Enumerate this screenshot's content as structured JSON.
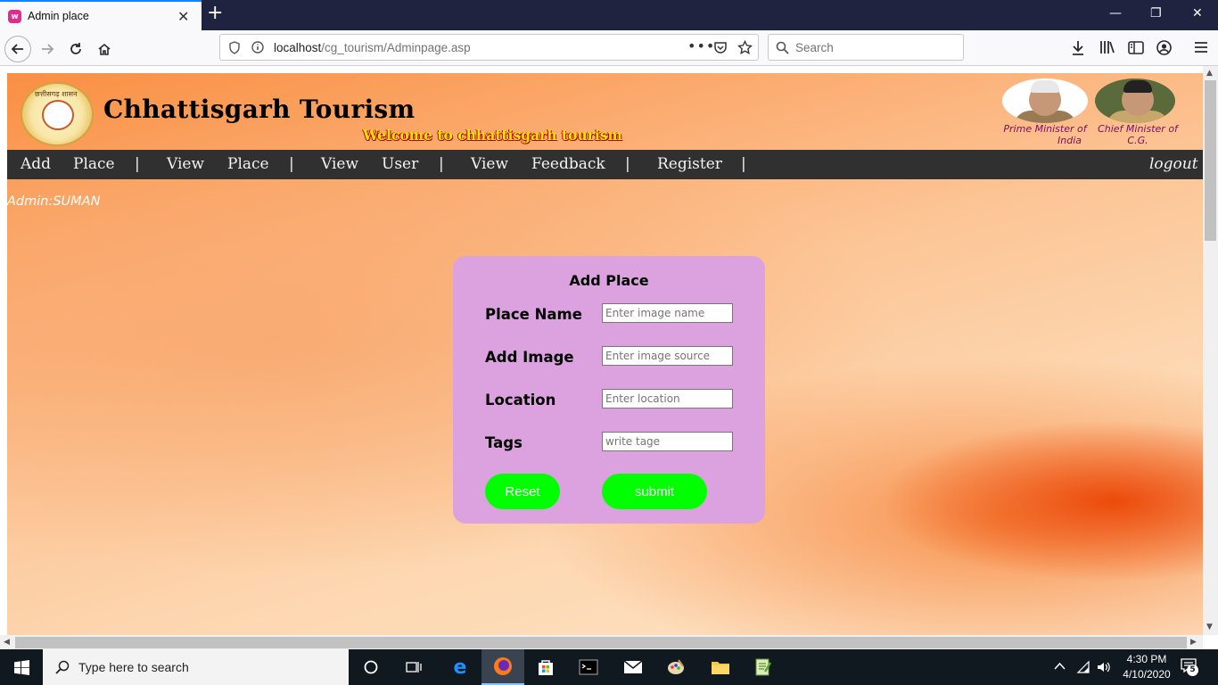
{
  "browser": {
    "tab_title": "Admin place",
    "tab_favicon_glyph": "w",
    "url_host": "localhost",
    "url_path": "/cg_tourism/Adminpage.asp",
    "search_placeholder": "Search"
  },
  "header": {
    "site_title": "Chhattisgarh Tourism",
    "welcome": "Welcome to chhattisgarh tourism",
    "emblem_text": "छत्तीसगढ़ शासन",
    "leaders": [
      {
        "caption_line1": "Prime Minister of",
        "caption_line2": "India"
      },
      {
        "caption_line1": "Chief Minister of",
        "caption_line2": "C.G."
      }
    ]
  },
  "menu": {
    "items": [
      "Add",
      "Place",
      "|",
      "View",
      "Place",
      "|",
      "View",
      "User",
      "|",
      "View",
      "Feedback",
      "|",
      "Register",
      "|"
    ],
    "logout": "logout"
  },
  "admin_label": "Admin:SUMAN",
  "form": {
    "title": "Add Place",
    "fields": [
      {
        "label": "Place Name",
        "placeholder": "Enter image name",
        "value": ""
      },
      {
        "label": "Add Image",
        "placeholder": "Enter image source",
        "value": ""
      },
      {
        "label": "Location",
        "placeholder": "Enter location",
        "value": ""
      },
      {
        "label": "Tags",
        "placeholder": "write tage",
        "value": ""
      }
    ],
    "reset_label": "Reset",
    "submit_label": "submit"
  },
  "taskbar": {
    "search_text": "Type here to search",
    "time": "4:30 PM",
    "date": "4/10/2020",
    "notification_count": "5"
  },
  "colors": {
    "menu_bg": "#303030",
    "card_bg": "#dba2df",
    "button_bg": "#00ff00",
    "welcome_text": "#ffe600",
    "accent_tab": "#0a84ff"
  }
}
